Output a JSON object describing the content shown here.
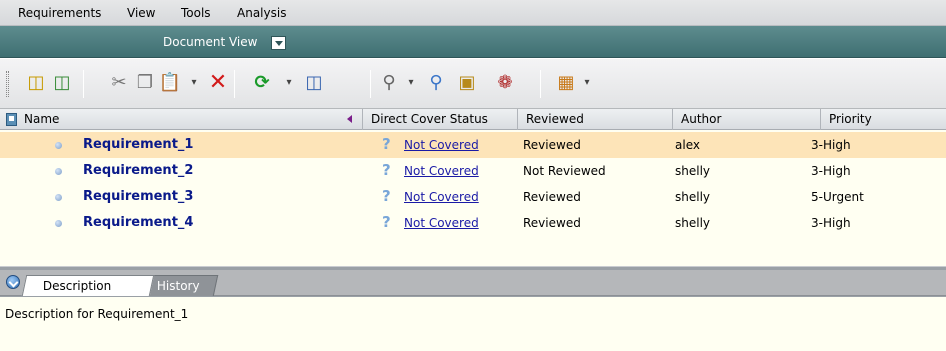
{
  "menu": [
    "Requirements",
    "View",
    "Tools",
    "Analysis"
  ],
  "view_bar": {
    "label": "Document View"
  },
  "toolbar": {
    "icons": [
      "new-requirement-icon",
      "new-child-requirement-icon",
      "cut-icon",
      "copy-icon",
      "paste-icon",
      "delete-icon",
      "refresh-icon",
      "columns-icon",
      "convert-icon",
      "find-icon",
      "attachment-icon",
      "defects-icon",
      "coverage-icon"
    ]
  },
  "grid": {
    "columns": [
      "Name",
      "Direct Cover Status",
      "Reviewed",
      "Author",
      "Priority"
    ],
    "rows": [
      {
        "name": "Requirement_1",
        "status": "Not Covered",
        "reviewed": "Reviewed",
        "author": "alex",
        "priority": "3-High",
        "selected": true
      },
      {
        "name": "Requirement_2",
        "status": "Not Covered",
        "reviewed": "Not Reviewed",
        "author": "shelly",
        "priority": "3-High"
      },
      {
        "name": "Requirement_3",
        "status": "Not Covered",
        "reviewed": "Reviewed",
        "author": "shelly",
        "priority": "5-Urgent"
      },
      {
        "name": "Requirement_4",
        "status": "Not Covered",
        "reviewed": "Reviewed",
        "author": "shelly",
        "priority": "3-High"
      }
    ]
  },
  "tabs": [
    "Description",
    "History"
  ],
  "description": "Description for Requirement_1",
  "colors": {
    "header_teal": "#4a7a7c",
    "selected_row": "#fde4b8",
    "grid_bg": "#fffff2",
    "link": "#1a1aa6",
    "req_name": "#0a1a8a"
  }
}
